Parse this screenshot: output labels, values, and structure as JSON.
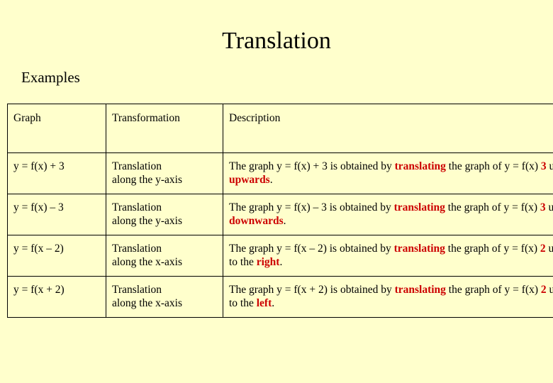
{
  "slide": {
    "title": "Translation",
    "subtitle": "Examples",
    "background_color": "#ffffcc",
    "accent_color": "#cc0000"
  },
  "table": {
    "headers": [
      "Graph",
      "Transformation",
      "Description"
    ],
    "rows": [
      {
        "graph": "y = f(x) + 3",
        "transformation_line1": "Translation",
        "transformation_line2": "along the y-axis",
        "desc_1": "The graph  y = f(x) + 3  is obtained by ",
        "desc_em1": "translating",
        "desc_2": " the graph of  y = f(x)  ",
        "desc_em2": "3",
        "desc_3": " units ",
        "desc_em3": "upwards",
        "desc_4": "."
      },
      {
        "graph": "y = f(x) – 3",
        "transformation_line1": "Translation",
        "transformation_line2": "along the y-axis",
        "desc_1": "The graph  y = f(x) – 3  is obtained by ",
        "desc_em1": "translating",
        "desc_2": " the graph of  y = f(x)  ",
        "desc_em2": "3",
        "desc_3": " units ",
        "desc_em3": "downwards",
        "desc_4": "."
      },
      {
        "graph": "y = f(x – 2)",
        "transformation_line1": "Translation",
        "transformation_line2": "along the x-axis",
        "desc_1": "The graph  y = f(x – 2)  is obtained by ",
        "desc_em1": "translating",
        "desc_2": " the graph of  y = f(x)  ",
        "desc_em2": "2",
        "desc_3": " units to the ",
        "desc_em3": "right",
        "desc_4": "."
      },
      {
        "graph": "y = f(x + 2)",
        "transformation_line1": "Translation",
        "transformation_line2": "along the x-axis",
        "desc_1": "The graph  y = f(x + 2)  is obtained by ",
        "desc_em1": "translating",
        "desc_2": " the graph of  y = f(x)  ",
        "desc_em2": "2",
        "desc_3": " units to the ",
        "desc_em3": "left",
        "desc_4": "."
      }
    ]
  }
}
